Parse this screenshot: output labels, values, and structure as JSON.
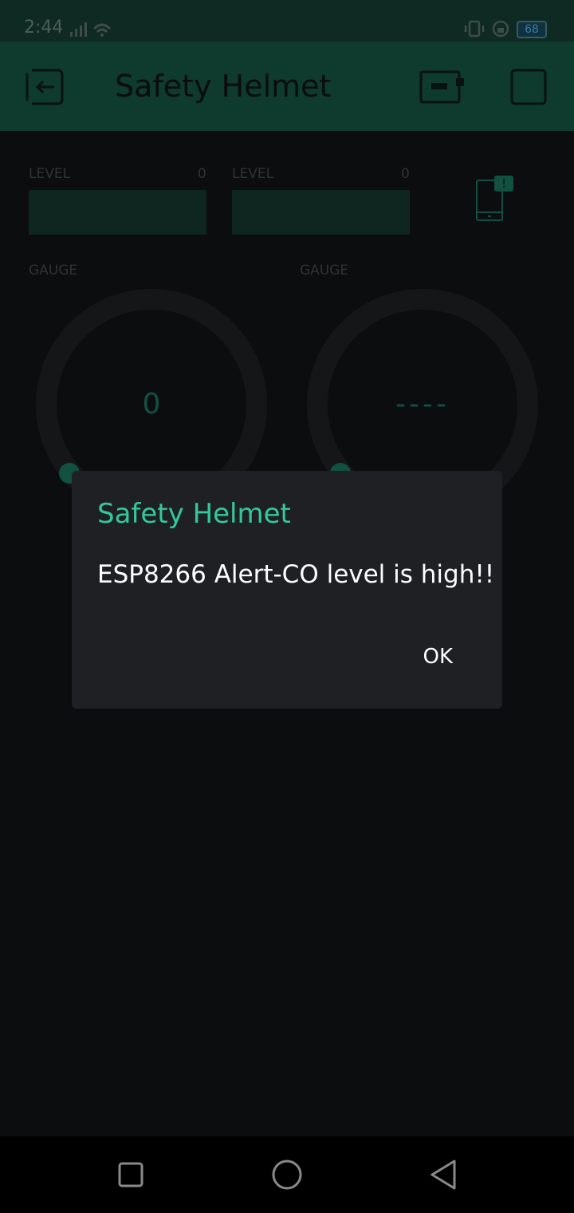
{
  "status_bar": {
    "time": "2:44",
    "battery": "68"
  },
  "app_bar": {
    "title": "Safety Helmet"
  },
  "widgets": {
    "level_1": {
      "label": "LEVEL",
      "value": "0"
    },
    "level_2": {
      "label": "LEVEL",
      "value": "0"
    },
    "gauge_1": {
      "label": "GAUGE",
      "value": "0"
    },
    "gauge_2": {
      "label": "GAUGE",
      "value": "----"
    }
  },
  "dialog": {
    "title": "Safety Helmet",
    "message": "ESP8266 Alert-CO level is high!!",
    "ok_label": "OK"
  },
  "colors": {
    "accent": "#33c89a",
    "app_bar": "#0f3a2e",
    "dialog_bg": "#1f2024"
  }
}
